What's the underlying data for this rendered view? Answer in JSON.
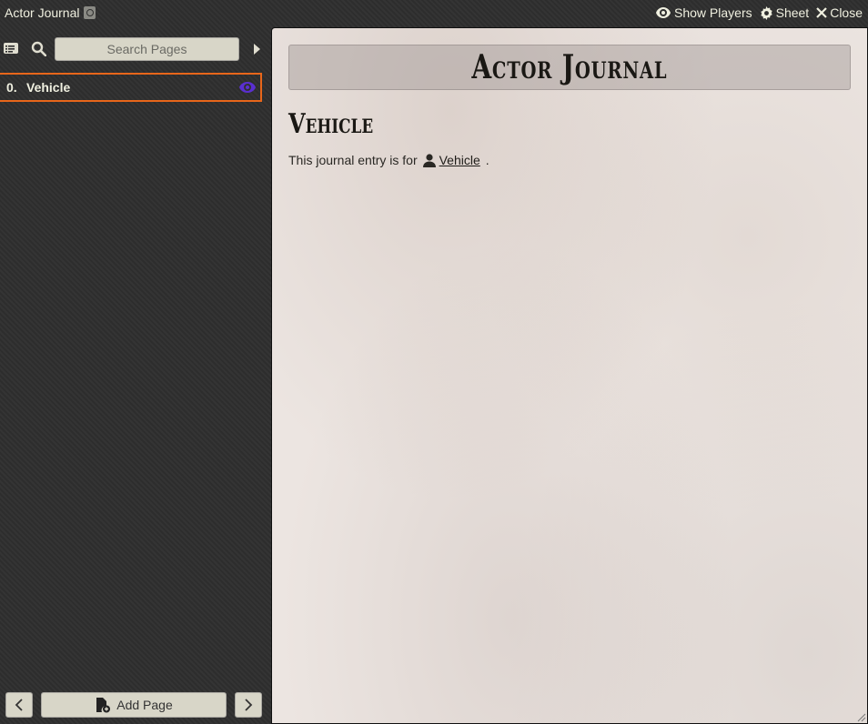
{
  "window": {
    "title": "Actor Journal",
    "controls": {
      "show_players": "Show Players",
      "sheet": "Sheet",
      "close": "Close"
    }
  },
  "sidebar": {
    "search_placeholder": "Search Pages",
    "pages": [
      {
        "number": "0.",
        "name": "Vehicle",
        "selected": true
      }
    ],
    "add_page": "Add Page"
  },
  "content": {
    "banner_title": "Actor Journal",
    "page_heading": "Vehicle",
    "entry_text": "This journal entry is for",
    "actor_link": "Vehicle",
    "trailing": "."
  },
  "colors": {
    "accent": "#e8661a",
    "visibility_icon": "#5a2fd0",
    "parchment": "#ece5e1"
  }
}
